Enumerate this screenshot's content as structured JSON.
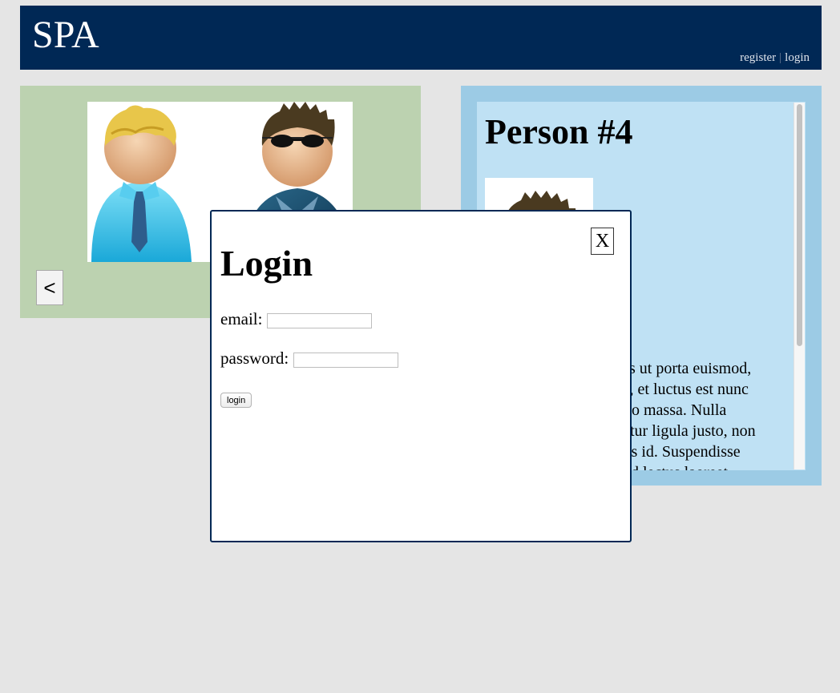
{
  "header": {
    "title": "SPA",
    "nav": {
      "register_label": "register",
      "separator": "|",
      "login_label": "login"
    }
  },
  "gallery": {
    "prev_label": "<",
    "image_alt": "two person avatars"
  },
  "detail": {
    "title": "Person #4",
    "visible_text_fragments": [
      "us ut porta euismod,",
      "i, et luctus est nunc",
      "o massa. Nulla",
      "tur ligula justo, non",
      "is id. Suspendisse",
      "d lectus laoreet"
    ]
  },
  "login_modal": {
    "close_label": "X",
    "title": "Login",
    "email_label": "email:",
    "email_value": "",
    "password_label": "password:",
    "password_value": "",
    "submit_label": "login"
  },
  "colors": {
    "header_bg": "#002855",
    "gallery_bg": "#bcd2b0",
    "detail_outer_bg": "#9ccbe5",
    "detail_inner_bg": "#bfe1f4",
    "page_bg": "#e5e5e5"
  },
  "icons": [
    "blond-businessman-avatar-icon",
    "sunglasses-man-avatar-icon"
  ]
}
